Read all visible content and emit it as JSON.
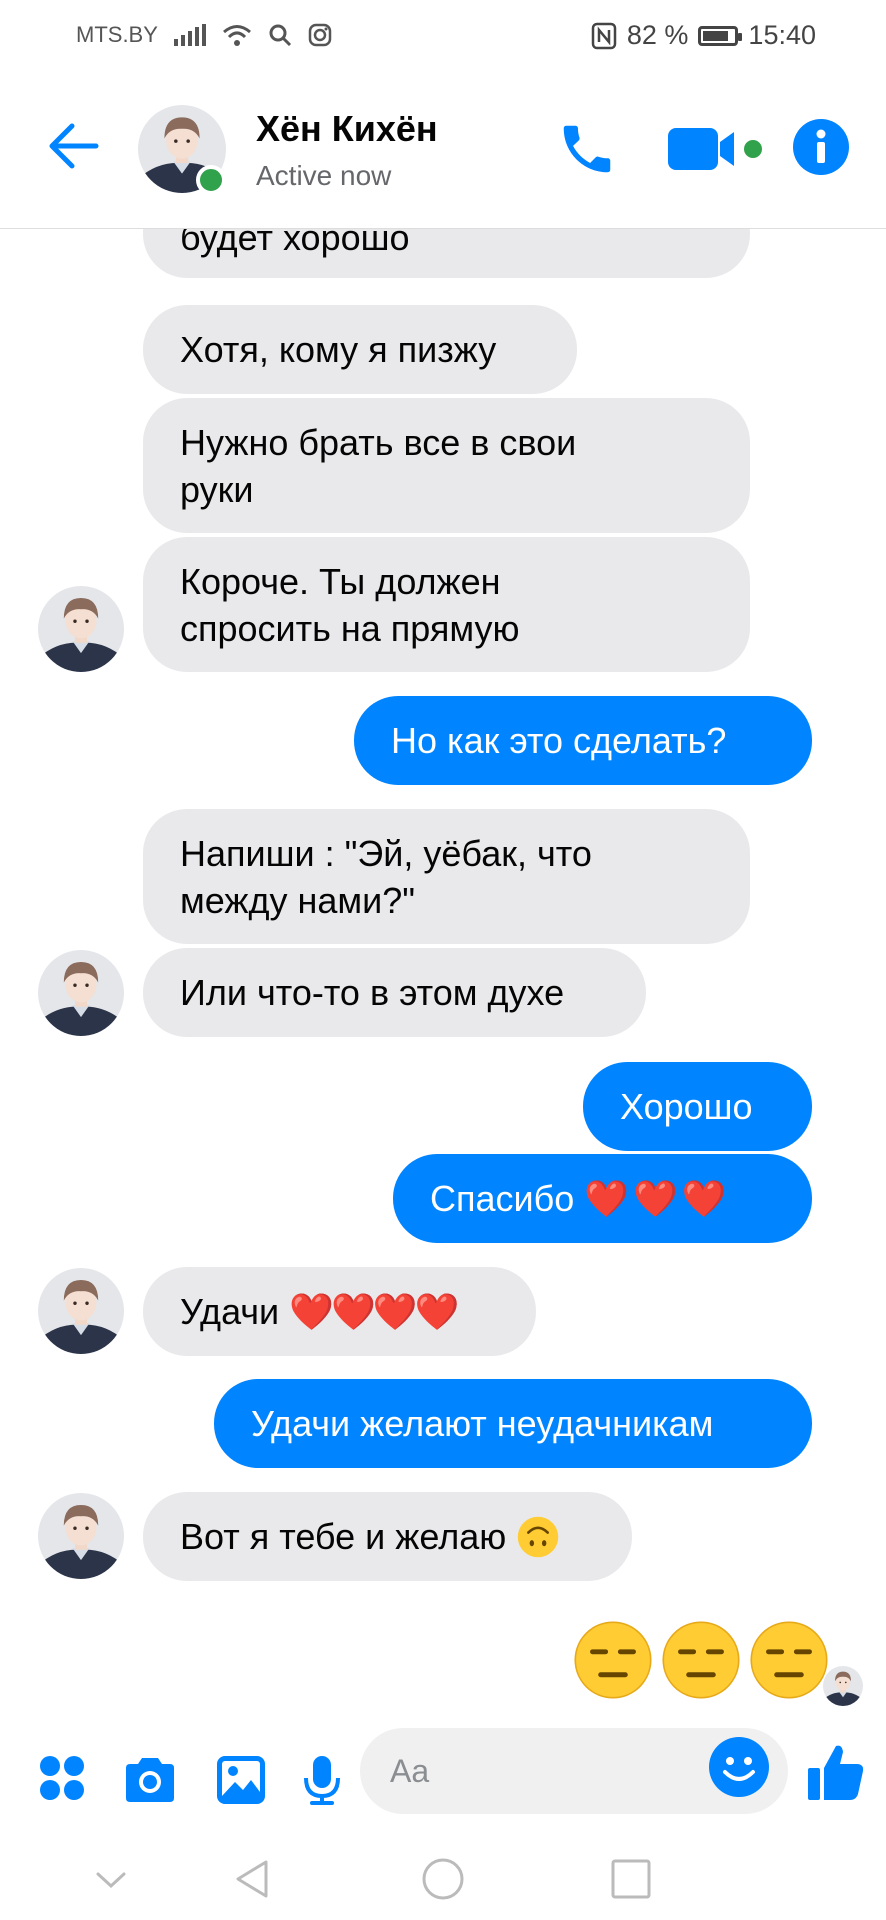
{
  "status_bar": {
    "carrier": "MTS.BY",
    "battery": "82 %",
    "battery_level": 0.82,
    "time": "15:40"
  },
  "header": {
    "name": "Хён Кихён",
    "status": "Active now"
  },
  "messages": [
    {
      "from": "them",
      "text": "будет хорошо"
    },
    {
      "from": "them",
      "text": "Хотя, кому я пизжу"
    },
    {
      "from": "them",
      "text": "Нужно брать все в свои\nруки"
    },
    {
      "from": "them",
      "text": "Короче. Ты должен\nспросить на прямую"
    },
    {
      "from": "me",
      "text": "Но как это сделать?"
    },
    {
      "from": "them",
      "text": "Напиши : \"Эй, уёбак, что\nмежду нами?\""
    },
    {
      "from": "them",
      "text": "Или что-то в этом духе"
    },
    {
      "from": "me",
      "text": "Хорошо"
    },
    {
      "from": "me",
      "text": "Спасибо",
      "hearts": "❤️ ❤️ ❤️"
    },
    {
      "from": "them",
      "text": "Удачи",
      "hearts": "❤️❤️❤️❤️"
    },
    {
      "from": "me",
      "text": "Удачи желают неудачникам"
    },
    {
      "from": "them",
      "text": "Вот я тебе и желаю",
      "emoji": "upside-down-face"
    },
    {
      "from": "me",
      "emoji": [
        "expressionless-face",
        "expressionless-face",
        "expressionless-face"
      ]
    }
  ],
  "composer": {
    "placeholder": "Aa"
  },
  "icons": {
    "accent": "#0084ff",
    "online": "#31a24c",
    "header": [
      "back-arrow-icon",
      "phone-icon",
      "video-camera-icon",
      "info-icon"
    ],
    "composer": [
      "apps-icon",
      "camera-icon",
      "gallery-icon",
      "microphone-icon",
      "emoji-icon",
      "thumbs-up-icon"
    ],
    "nav": [
      "nav-down-icon",
      "nav-back-icon",
      "nav-home-icon",
      "nav-recents-icon"
    ]
  }
}
